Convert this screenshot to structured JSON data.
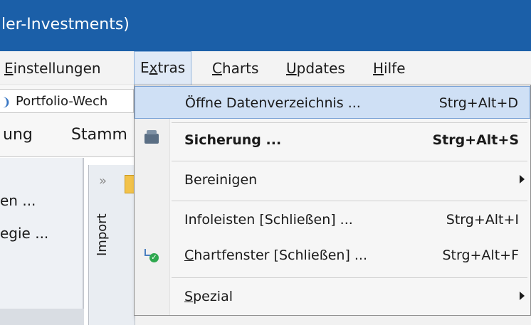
{
  "window": {
    "title": "ler-Investments)"
  },
  "menubar": {
    "items": [
      {
        "label": "Einstellungen"
      },
      {
        "label": "Extras"
      },
      {
        "label": "Charts"
      },
      {
        "label": "Updates"
      },
      {
        "label": "Hilfe"
      }
    ]
  },
  "quicktab": {
    "label": "Portfolio-Wech"
  },
  "ribbon": {
    "tabs": [
      {
        "label": "ung"
      },
      {
        "label": "Stamm"
      }
    ]
  },
  "leftpanel": {
    "items": [
      {
        "label": "en ..."
      },
      {
        "label": "egie ..."
      }
    ]
  },
  "importpanel": {
    "label": "Import",
    "chevron": "»"
  },
  "dropdown": {
    "items": [
      {
        "label": "Öffne Datenverzeichnis ...",
        "shortcut": "Strg+Alt+D"
      },
      {
        "label": "Sicherung ...",
        "shortcut": "Strg+Alt+S",
        "icon": "save-icon"
      },
      {
        "label": "Bereinigen",
        "shortcut": ""
      },
      {
        "label": "Infoleisten [Schließen] ...",
        "shortcut": "Strg+Alt+I"
      },
      {
        "label": "Chartfenster [Schließen] ...",
        "shortcut": "Strg+Alt+F",
        "icon": "chart-check-icon"
      },
      {
        "label": "Spezial",
        "shortcut": ""
      }
    ]
  },
  "colors": {
    "titlebar": "#1b5fa8",
    "highlight": "#cfe0f5",
    "highlight_border": "#7ba3d6"
  }
}
